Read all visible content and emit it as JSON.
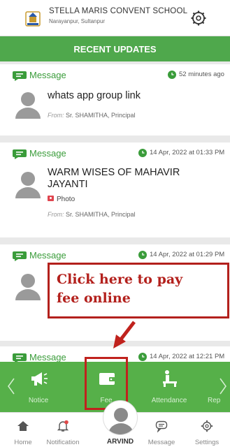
{
  "header": {
    "school_name": "STELLA MARIS CONVENT SCHOOL",
    "location": "Narayanpur, Sultanpur"
  },
  "updates_bar": {
    "title": "RECENT UPDATES"
  },
  "feed": [
    {
      "type": "Message",
      "time": "52 minutes ago",
      "title": "whats app group link",
      "from_prefix": "From:",
      "from_name": "Sr. SHAMITHA, Principal"
    },
    {
      "type": "Message",
      "time": "14 Apr, 2022 at 01:33 PM",
      "title_line1": "WARM WISES OF MAHAVIR",
      "title_line2": "JAYANTI",
      "attachment": "Photo",
      "from_prefix": "From:",
      "from_name": "Sr. SHAMITHA, Principal"
    },
    {
      "type": "Message",
      "time": "14 Apr, 2022 at 01:29 PM"
    },
    {
      "type": "Message",
      "time": "14 Apr, 2022 at 12:21 PM"
    }
  ],
  "callout": {
    "line1": "Click here to pay",
    "line2": "fee online",
    "color": "#b3201c"
  },
  "quick_nav": {
    "items": [
      {
        "label": "Notice",
        "icon": "megaphone-icon"
      },
      {
        "label": "Fee",
        "icon": "wallet-icon"
      },
      {
        "label": "Attendance",
        "icon": "desk-icon"
      },
      {
        "label": "Rep",
        "icon": "report-icon"
      }
    ]
  },
  "tabbar": {
    "items": [
      {
        "label": "Home",
        "icon": "home-icon"
      },
      {
        "label": "Notification",
        "icon": "bell-icon"
      },
      {
        "label": "ARVIND",
        "icon": "avatar"
      },
      {
        "label": "Message",
        "icon": "chat-icon"
      },
      {
        "label": "Settings",
        "icon": "gear-icon"
      }
    ]
  },
  "colors": {
    "green": "#4fa84c",
    "nav_green": "#56b049",
    "accent_red": "#b3201c"
  }
}
